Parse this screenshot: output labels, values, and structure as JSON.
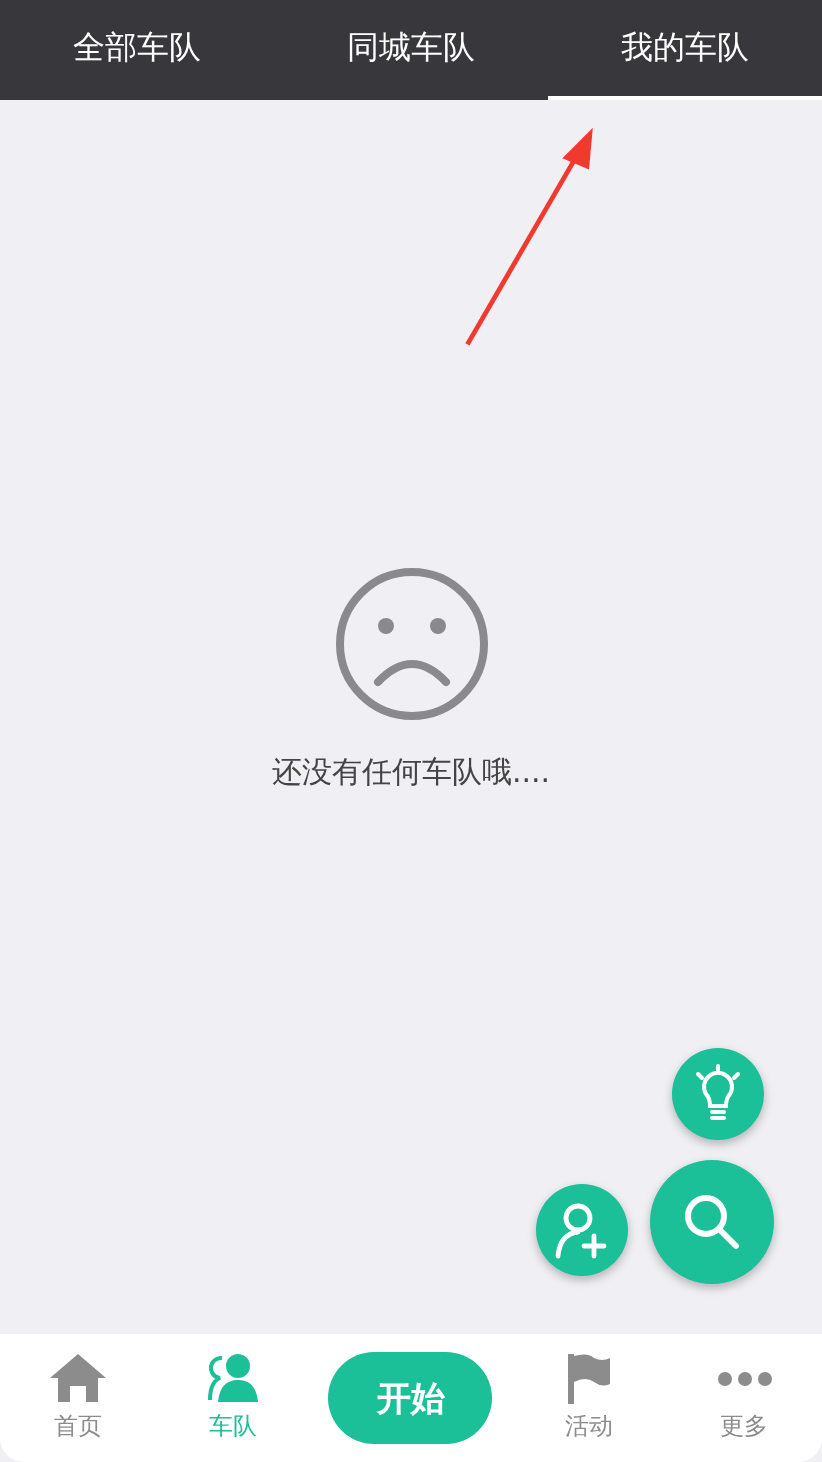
{
  "tabs": [
    {
      "label": "全部车队",
      "selected": false
    },
    {
      "label": "同城车队",
      "selected": false
    },
    {
      "label": "我的车队",
      "selected": true
    }
  ],
  "empty_state": {
    "message": "还没有任何车队哦...."
  },
  "bottom_nav": [
    {
      "kind": "home",
      "label": "首页",
      "selected": false
    },
    {
      "kind": "team",
      "label": "车队",
      "selected": true
    },
    {
      "kind": "button",
      "label": "开始"
    },
    {
      "kind": "flag",
      "label": "活动",
      "selected": false
    },
    {
      "kind": "more",
      "label": "更多",
      "selected": false
    }
  ]
}
